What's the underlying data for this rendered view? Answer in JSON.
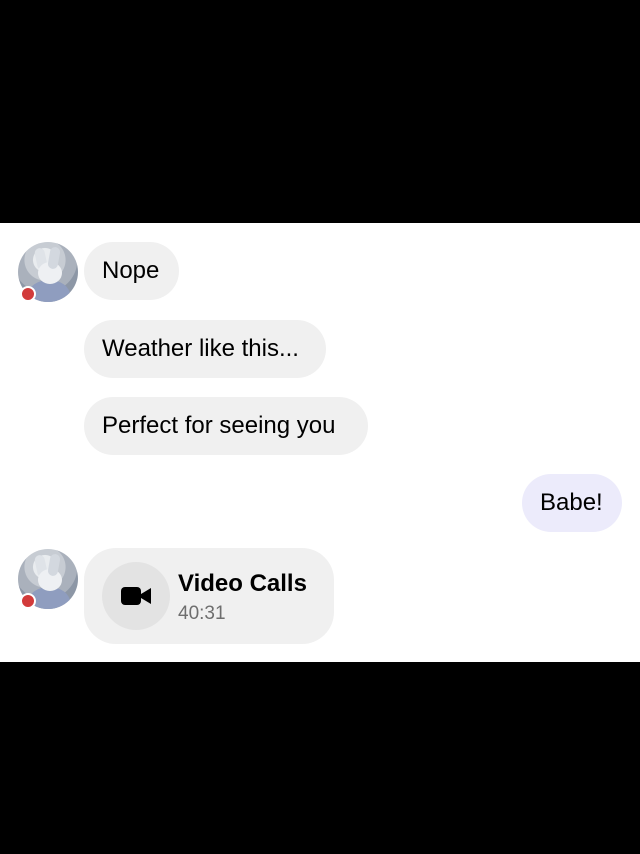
{
  "conversation": {
    "messages": [
      {
        "direction": "incoming",
        "text": "Nope"
      },
      {
        "direction": "incoming",
        "text": "Weather like this..."
      },
      {
        "direction": "incoming",
        "text": "Perfect for seeing you"
      },
      {
        "direction": "outgoing",
        "text": "Babe!"
      }
    ],
    "call": {
      "icon": "video-camera-icon",
      "title": "Video Calls",
      "duration": "40:31"
    }
  },
  "colors": {
    "incoming_bubble": "#f0f0f0",
    "outgoing_bubble": "#ecebfb",
    "status_dot": "#d23b3b"
  }
}
